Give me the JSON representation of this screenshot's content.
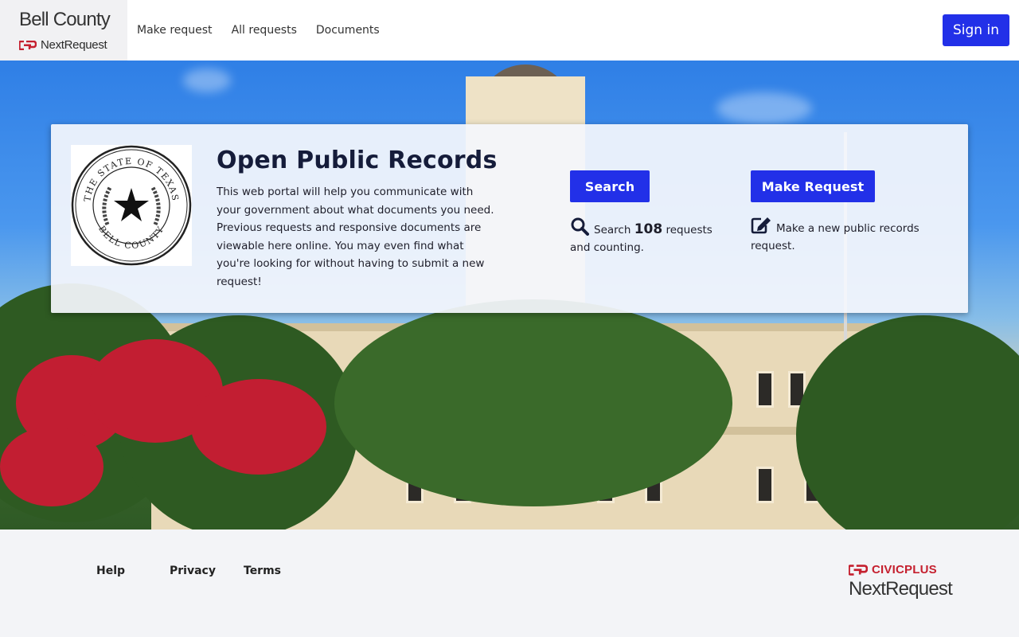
{
  "header": {
    "brand_name": "Bell County",
    "brand_sub": "NextRequest",
    "nav": [
      {
        "label": "Make request"
      },
      {
        "label": "All requests"
      },
      {
        "label": "Documents"
      }
    ],
    "signin_label": "Sign in"
  },
  "card": {
    "seal_top_text": "THE STATE OF TEXAS",
    "seal_bottom_text": "BELL COUNTY",
    "title": "Open Public Records",
    "description": "This web portal will help you communicate with your government about what documents you need. Previous requests and responsive documents are viewable here online. You may even find what you're looking for without having to submit a new request!",
    "search": {
      "button_label": "Search",
      "text_prefix": "Search",
      "count": "108",
      "text_suffix": "requests and counting.",
      "icon": "search-icon"
    },
    "make": {
      "button_label": "Make Request",
      "text": "Make a new public records request.",
      "icon": "edit-icon"
    }
  },
  "footer": {
    "links": [
      {
        "label": "Help"
      },
      {
        "label": "Privacy"
      },
      {
        "label": "Terms"
      }
    ],
    "civic_top": "CIVICPLUS",
    "civic_bottom": "NextRequest"
  },
  "colors": {
    "primary_button": "#2230e8",
    "civic_red": "#c5202f",
    "title_navy": "#151c3a"
  }
}
